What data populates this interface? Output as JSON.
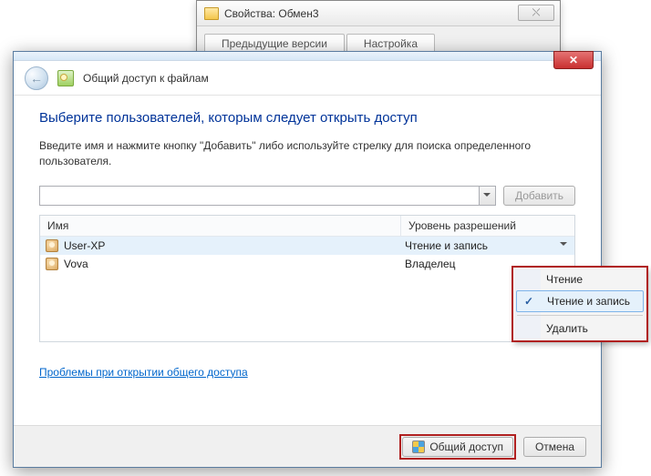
{
  "bg_dialog": {
    "title": "Свойства: Обмен3",
    "close_glyph": "⤬",
    "tabs": [
      "Предыдущие версии",
      "Настройка"
    ]
  },
  "header": {
    "title": "Общий доступ к файлам",
    "back_glyph": "←",
    "close_glyph": "✕"
  },
  "main": {
    "heading": "Выберите пользователей, которым следует открыть доступ",
    "instruction": "Введите имя и нажмите кнопку \"Добавить\" либо используйте стрелку для поиска определенного пользователя.",
    "add_button": "Добавить"
  },
  "table": {
    "col_name": "Имя",
    "col_perm": "Уровень разрешений",
    "rows": [
      {
        "name": "User-XP",
        "perm": "Чтение и запись",
        "has_dropdown": true
      },
      {
        "name": "Vova",
        "perm": "Владелец",
        "has_dropdown": false
      }
    ]
  },
  "link": "Проблемы при открытии общего доступа",
  "footer": {
    "share": "Общий доступ",
    "cancel": "Отмена"
  },
  "perm_menu": {
    "items": [
      "Чтение",
      "Чтение и запись"
    ],
    "selected": "Чтение и запись",
    "delete": "Удалить"
  }
}
